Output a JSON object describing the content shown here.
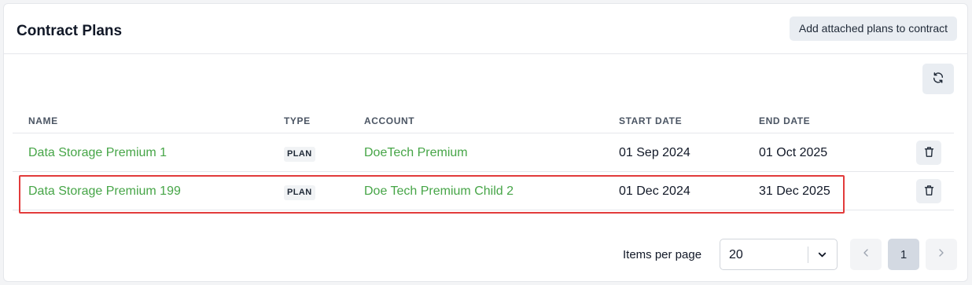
{
  "header": {
    "title": "Contract Plans",
    "add_button": "Add attached plans to contract",
    "refresh_icon": "refresh-icon"
  },
  "table": {
    "columns": [
      "NAME",
      "TYPE",
      "ACCOUNT",
      "START DATE",
      "END DATE"
    ],
    "rows": [
      {
        "name": "Data Storage Premium 1",
        "type": "PLAN",
        "account": "DoeTech Premium",
        "start": "01 Sep 2024",
        "end": "01 Oct 2025"
      },
      {
        "name": "Data Storage Premium 199",
        "type": "PLAN",
        "account": "Doe Tech Premium Child 2",
        "start": "01 Dec 2024",
        "end": "31 Dec 2025"
      }
    ],
    "row_action_icon": "trash-icon"
  },
  "pagination": {
    "items_per_page_label": "Items per page",
    "items_per_page_value": "20",
    "current_page": "1"
  },
  "colors": {
    "link": "#46a547",
    "highlight": "#e23b3b"
  }
}
